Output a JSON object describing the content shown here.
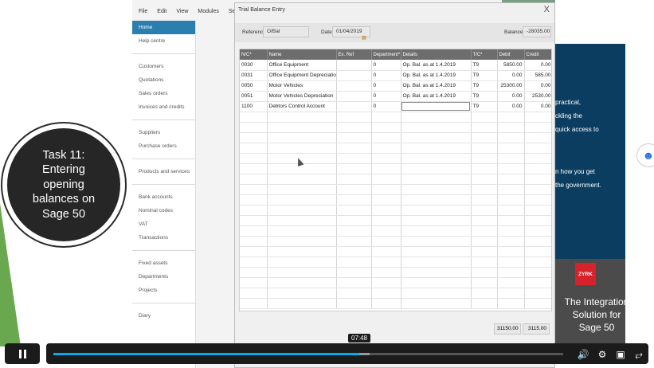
{
  "app": {
    "menu": [
      "File",
      "Edit",
      "View",
      "Modules",
      "Settings"
    ],
    "nav_groups": [
      [
        "Home",
        "Help centre"
      ],
      [
        "Customers",
        "Quotations",
        "Sales orders",
        "Invoices and credits"
      ],
      [
        "Suppliers",
        "Purchase orders"
      ],
      [
        "Products and services"
      ],
      [
        "Bank accounts",
        "Nominal codes",
        "VAT",
        "Transactions"
      ],
      [
        "Fixed assets",
        "Departments",
        "Projects"
      ],
      [
        "Diary"
      ]
    ]
  },
  "dialog": {
    "title": "Trial Balance Entry",
    "close": "X",
    "reference_label": "Reference",
    "reference_value": "O/Bal",
    "date_label": "Date",
    "date_value": "01/04/2019",
    "balance_label": "Balance",
    "balance_value": "-28035.00",
    "columns": [
      "N/C*",
      "Name",
      "Ex. Ref",
      "Department*",
      "Details",
      "T/C*",
      "Debit",
      "Credit"
    ],
    "rows": [
      [
        "0030",
        "Office Equipment",
        "",
        "0",
        "Op. Bal. as at 1.4.2019",
        "T9",
        "5850.00",
        "0.00"
      ],
      [
        "0031",
        "Office Equipment Depreciation",
        "",
        "0",
        "Op. Bal. as at 1.4.2019",
        "T9",
        "0.00",
        "585.00"
      ],
      [
        "0050",
        "Motor Vehicles",
        "",
        "0",
        "Op. Bal. as at 1.4.2019",
        "T9",
        "25300.00",
        "0.00"
      ],
      [
        "0051",
        "Motor Vehicles Depreciation",
        "",
        "0",
        "Op. Bal. as at 1.4.2019",
        "T9",
        "0.00",
        "2530.00"
      ],
      [
        "1100",
        "Debtors Control Account",
        "",
        "0",
        "",
        "T9",
        "0.00",
        "0.00"
      ]
    ],
    "total_debit": "31150.00",
    "total_credit": "3115.00"
  },
  "overlay": {
    "task_lines": [
      "Task 11:",
      "Entering",
      "opening",
      "balances on",
      "Sage 50"
    ]
  },
  "slide": {
    "text_lines": [
      "practical,",
      "ckling the",
      "quick access to"
    ],
    "text_lines2": [
      "n how you get",
      "the government."
    ],
    "logo": "ZYRK",
    "integration_lines": [
      "The Integration",
      "Solution for",
      "Sage 50"
    ]
  },
  "player": {
    "time": "07:48",
    "progress": 0.6,
    "buffered_end": 0.62
  }
}
